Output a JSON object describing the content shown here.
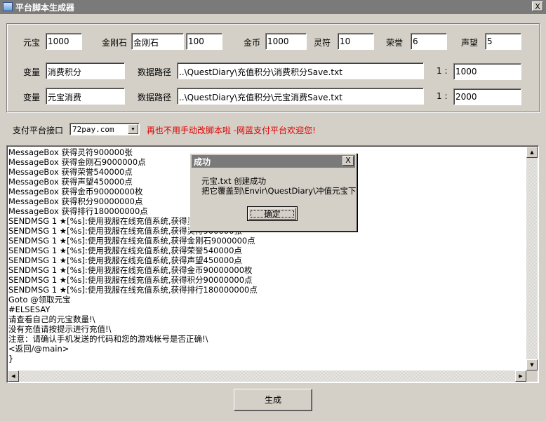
{
  "window": {
    "title": "平台脚本生成器",
    "close_label": "X"
  },
  "row1": {
    "yuanbao_label": "元宝",
    "yuanbao_value": "1000",
    "jingangshi_label": "金刚石",
    "jingangshi_name": "金刚石",
    "jingangshi_value": "100",
    "jinbi_label": "金币",
    "jinbi_value": "1000",
    "lingfu_label": "灵符",
    "lingfu_value": "10",
    "rongyu_label": "荣誉",
    "rongyu_value": "6",
    "shengwang_label": "声望",
    "shengwang_value": "5"
  },
  "row2": {
    "var_label": "变量",
    "var_value": "消费积分",
    "path_label": "数据路径",
    "path_value": "..\\QuestDiary\\充值积分\\消费积分Save.txt",
    "ratio_label": "1 :",
    "ratio_value": "1000"
  },
  "row3": {
    "var_label": "变量",
    "var_value": "元宝消费",
    "path_label": "数据路径",
    "path_value": "..\\QuestDiary\\充值积分\\元宝消费Save.txt",
    "ratio_label": "1 :",
    "ratio_value": "2000"
  },
  "payment": {
    "label": "支付平台接口",
    "selected": "72pay.com",
    "promo": "再也不用手动改脚本啦 -网蓝支付平台欢迎您!"
  },
  "script_text": "MessageBox 获得灵符900000张\nMessageBox 获得金刚石9000000点\nMessageBox 获得荣誉540000点\nMessageBox 获得声望450000点\nMessageBox 获得金币90000000枚\nMessageBox 获得积分90000000点\nMessageBox 获得排行180000000点\nSENDMSG 1 ★[%s]:使用我服在线充值系统,获得灵符900000张\nSENDMSG 1 ★[%s]:使用我服在线充值系统,获得灵符900000张\nSENDMSG 1 ★[%s]:使用我服在线充值系统,获得金刚石9000000点\nSENDMSG 1 ★[%s]:使用我服在线充值系统,获得荣誉540000点\nSENDMSG 1 ★[%s]:使用我服在线充值系统,获得声望450000点\nSENDMSG 1 ★[%s]:使用我服在线充值系统,获得金币90000000枚\nSENDMSG 1 ★[%s]:使用我服在线充值系统,获得积分90000000点\nSENDMSG 1 ★[%s]:使用我服在线充值系统,获得排行180000000点\nGoto @领取元宝\n#ELSESAY\n请查看自己的元宝数量!\\\n没有充值请按提示进行充值!\\\n注意：请确认手机发送的代码和您的游戏帐号是否正确!\\\n<返回/@main>\n}",
  "dialog": {
    "title": "成功",
    "close_label": "X",
    "line1": "元宝.txt 创建成功",
    "line2": "把它覆盖到\\Envir\\QuestDiary\\冲值元宝下",
    "ok_label": "确定"
  },
  "generate_label": "生成",
  "icons": {
    "app": "app-icon",
    "close": "close-icon",
    "dropdown": "chevron-down-icon",
    "scroll_up": "arrow-up-icon",
    "scroll_down": "arrow-down-icon",
    "scroll_left": "arrow-left-icon",
    "scroll_right": "arrow-right-icon"
  },
  "colors": {
    "title_bar": "#7a7a7a",
    "face": "#d4d0c8",
    "promo_text": "#e00000"
  }
}
